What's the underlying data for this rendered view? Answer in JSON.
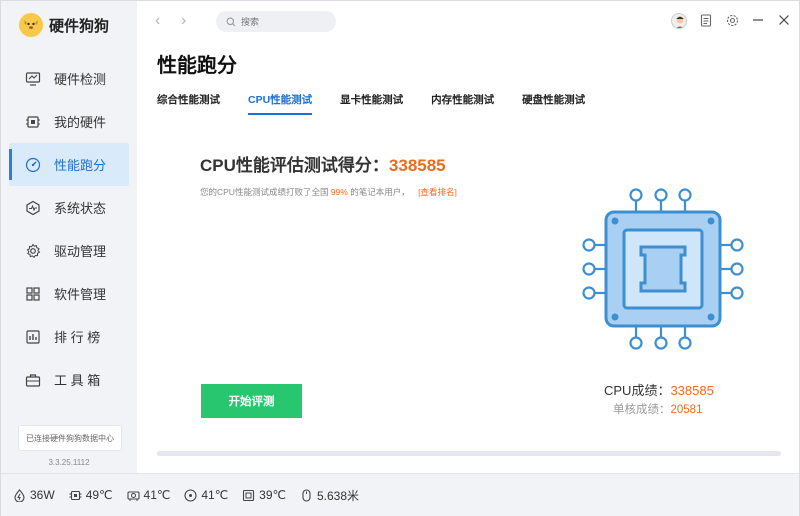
{
  "app": {
    "name": "硬件狗狗"
  },
  "search": {
    "placeholder": "搜索"
  },
  "sidebar": {
    "items": [
      {
        "label": "硬件检测",
        "icon": "monitor-icon"
      },
      {
        "label": "我的硬件",
        "icon": "chip-icon"
      },
      {
        "label": "性能跑分",
        "icon": "gauge-icon",
        "active": true
      },
      {
        "label": "系统状态",
        "icon": "pulse-icon"
      },
      {
        "label": "驱动管理",
        "icon": "gear-icon"
      },
      {
        "label": "软件管理",
        "icon": "apps-icon"
      },
      {
        "label": "排 行 榜",
        "icon": "ranking-icon"
      },
      {
        "label": "工 具 箱",
        "icon": "toolbox-icon"
      }
    ],
    "sync_text": "已连接硬件狗狗数据中心",
    "version": "3.3.25.1112"
  },
  "page": {
    "title": "性能跑分",
    "tabs": [
      {
        "label": "综合性能测试"
      },
      {
        "label": "CPU性能测试",
        "active": true
      },
      {
        "label": "显卡性能测试"
      },
      {
        "label": "内存性能测试"
      },
      {
        "label": "硬盘性能测试"
      }
    ]
  },
  "score": {
    "title_prefix": "CPU性能评估测试得分：",
    "value": "338585",
    "rank_prefix": "您的CPU性能测试成绩打败了全国",
    "rank_percent": "99%",
    "rank_suffix": "的笔记本用户，",
    "rank_link": "[查看排名]",
    "cpu_label": "CPU成绩：",
    "cpu_value": "338585",
    "single_label": "单核成绩：",
    "single_value": "20581"
  },
  "actions": {
    "start_label": "开始评测"
  },
  "status": [
    {
      "icon": "power-icon",
      "value": "36W"
    },
    {
      "icon": "cpu-temp-icon",
      "value": "49℃"
    },
    {
      "icon": "gpu-temp-icon",
      "value": "41℃"
    },
    {
      "icon": "disk-temp-icon",
      "value": "41℃"
    },
    {
      "icon": "board-temp-icon",
      "value": "39℃"
    },
    {
      "icon": "mouse-icon",
      "value": "5.638米"
    }
  ],
  "colors": {
    "accent": "#1e6fd1",
    "score": "#f26a1b",
    "start_button": "#28c76f",
    "chip": "#3d8fd1"
  }
}
